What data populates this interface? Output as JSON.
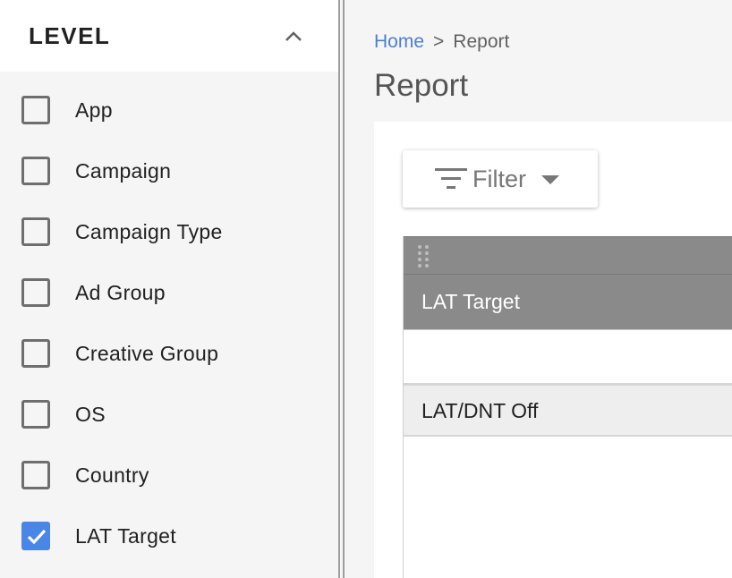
{
  "level_panel": {
    "title": "LEVEL",
    "collapse_icon": "chevron-up-icon",
    "items": [
      {
        "label": "App",
        "checked": false
      },
      {
        "label": "Campaign",
        "checked": false
      },
      {
        "label": "Campaign Type",
        "checked": false
      },
      {
        "label": "Ad Group",
        "checked": false
      },
      {
        "label": "Creative Group",
        "checked": false
      },
      {
        "label": "OS",
        "checked": false
      },
      {
        "label": "Country",
        "checked": false
      },
      {
        "label": "LAT Target",
        "checked": true
      }
    ]
  },
  "breadcrumb": {
    "home": "Home",
    "separator": ">",
    "current": "Report"
  },
  "page_title": "Report",
  "filter": {
    "label": "Filter",
    "icon": "filter-icon",
    "caret_icon": "caret-down-icon"
  },
  "table": {
    "drag_icon": "drag-handle-icon",
    "columns": [
      "LAT Target"
    ],
    "rows": [
      [
        "LAT/DNT Off"
      ]
    ]
  },
  "colors": {
    "accent": "#4a86e8",
    "link": "#4a7fd4",
    "header_bg": "#8a8a8a",
    "panel_bg": "#f5f5f5"
  }
}
